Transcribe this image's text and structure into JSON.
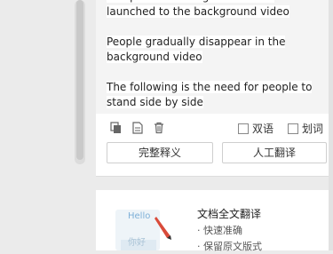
{
  "result": {
    "paragraphs": [
      "The poison in the green clear is launched to the background video",
      "People gradually disappear in the background video",
      "The following is the need for people to stand side by side"
    ]
  },
  "toolbar": {
    "bilingual_label": "双语",
    "word_select_label": "划词"
  },
  "buttons": {
    "full_definition": "完整释义",
    "human_translation": "人工翻译"
  },
  "promo": {
    "title": "文档全文翻译",
    "items": [
      "· 快速准确",
      "· 保留原文版式"
    ],
    "illus_hello": "Hello",
    "illus_nihao": "你好"
  }
}
